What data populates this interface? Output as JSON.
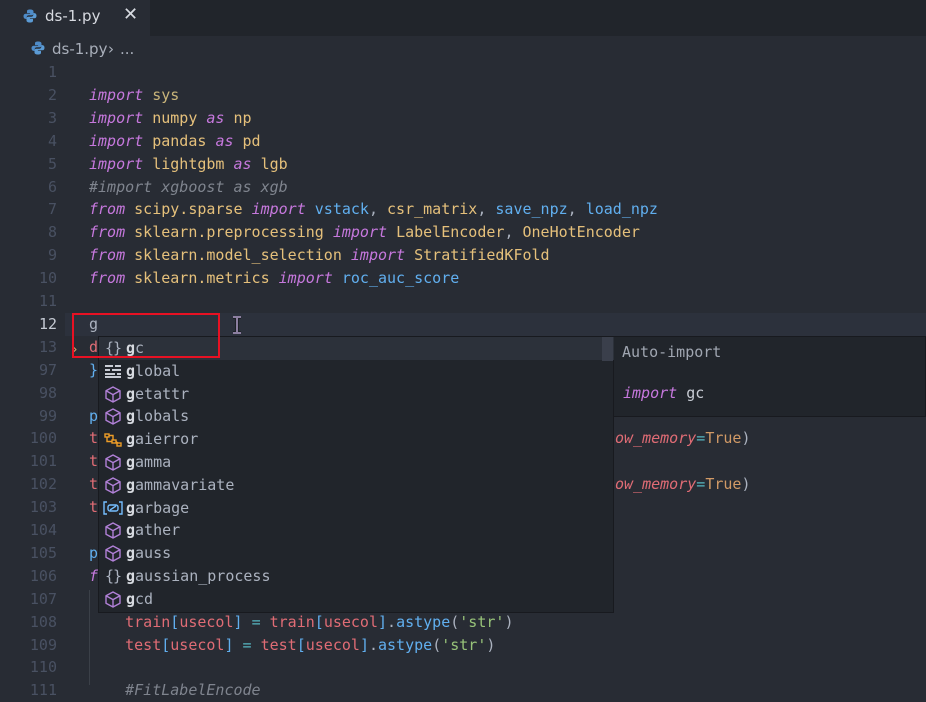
{
  "tab": {
    "filename": "ds-1.py",
    "close_glyph": "✕"
  },
  "breadcrumb": {
    "file": "ds-1.py",
    "separator": "›",
    "more": "..."
  },
  "editor": {
    "current_line": 12,
    "lines": [
      {
        "n": "1",
        "tokens": []
      },
      {
        "n": "2",
        "tokens": [
          [
            "kw",
            "import"
          ],
          [
            "pl",
            " "
          ],
          [
            "modd",
            "sys"
          ]
        ]
      },
      {
        "n": "3",
        "tokens": [
          [
            "kw",
            "import"
          ],
          [
            "pl",
            " "
          ],
          [
            "mod",
            "numpy"
          ],
          [
            "pl",
            " "
          ],
          [
            "kw",
            "as"
          ],
          [
            "pl",
            " "
          ],
          [
            "mod",
            "np"
          ]
        ]
      },
      {
        "n": "4",
        "tokens": [
          [
            "kw",
            "import"
          ],
          [
            "pl",
            " "
          ],
          [
            "mod",
            "pandas"
          ],
          [
            "pl",
            " "
          ],
          [
            "kw",
            "as"
          ],
          [
            "pl",
            " "
          ],
          [
            "mod",
            "pd"
          ]
        ]
      },
      {
        "n": "5",
        "tokens": [
          [
            "kw",
            "import"
          ],
          [
            "pl",
            " "
          ],
          [
            "mod",
            "lightgbm"
          ],
          [
            "pl",
            " "
          ],
          [
            "kw",
            "as"
          ],
          [
            "pl",
            " "
          ],
          [
            "mod",
            "lgb"
          ]
        ]
      },
      {
        "n": "6",
        "tokens": [
          [
            "cm",
            "#import xgboost as xgb"
          ]
        ]
      },
      {
        "n": "7",
        "tokens": [
          [
            "kw",
            "from"
          ],
          [
            "pl",
            " "
          ],
          [
            "mod",
            "scipy.sparse"
          ],
          [
            "pl",
            " "
          ],
          [
            "kw",
            "import"
          ],
          [
            "pl",
            " "
          ],
          [
            "fn",
            "vstack"
          ],
          [
            "pl",
            ", "
          ],
          [
            "mod",
            "csr_matrix"
          ],
          [
            "pl",
            ", "
          ],
          [
            "fn",
            "save_npz"
          ],
          [
            "pl",
            ", "
          ],
          [
            "fn",
            "load_npz"
          ]
        ]
      },
      {
        "n": "8",
        "tokens": [
          [
            "kw",
            "from"
          ],
          [
            "pl",
            " "
          ],
          [
            "mod",
            "sklearn.preprocessing"
          ],
          [
            "pl",
            " "
          ],
          [
            "kw",
            "import"
          ],
          [
            "pl",
            " "
          ],
          [
            "mod",
            "LabelEncoder"
          ],
          [
            "pl",
            ", "
          ],
          [
            "mod",
            "OneHotEncoder"
          ]
        ]
      },
      {
        "n": "9",
        "tokens": [
          [
            "kw",
            "from"
          ],
          [
            "pl",
            " "
          ],
          [
            "mod",
            "sklearn.model_selection"
          ],
          [
            "pl",
            " "
          ],
          [
            "kw",
            "import"
          ],
          [
            "pl",
            " "
          ],
          [
            "mod",
            "StratifiedKFold"
          ]
        ]
      },
      {
        "n": "10",
        "tokens": [
          [
            "kw",
            "from"
          ],
          [
            "pl",
            " "
          ],
          [
            "mod",
            "sklearn.metrics"
          ],
          [
            "pl",
            " "
          ],
          [
            "kw",
            "import"
          ],
          [
            "pl",
            " "
          ],
          [
            "fn",
            "roc_auc_score"
          ]
        ]
      },
      {
        "n": "11",
        "tokens": []
      },
      {
        "n": "12",
        "tokens": [
          [
            "pl",
            "g"
          ]
        ]
      },
      {
        "n": "13",
        "tokens": [
          [
            "var",
            "d"
          ]
        ]
      },
      {
        "n": "97",
        "tokens": [
          [
            "fn",
            "}"
          ]
        ]
      },
      {
        "n": "98",
        "tokens": []
      },
      {
        "n": "99",
        "tokens": [
          [
            "fn",
            "p"
          ]
        ]
      },
      {
        "n": "100",
        "tokens": [
          [
            "var",
            "t"
          ]
        ]
      },
      {
        "n": "101",
        "tokens": [
          [
            "var",
            "t"
          ]
        ]
      },
      {
        "n": "102",
        "tokens": [
          [
            "var",
            "t"
          ]
        ]
      },
      {
        "n": "103",
        "tokens": [
          [
            "var",
            "t"
          ]
        ]
      },
      {
        "n": "104",
        "tokens": []
      },
      {
        "n": "105",
        "tokens": [
          [
            "fn",
            "p"
          ]
        ]
      },
      {
        "n": "106",
        "tokens": [
          [
            "kw",
            "f"
          ]
        ]
      },
      {
        "n": "107",
        "tokens": []
      },
      {
        "n": "108",
        "tokens": [
          [
            "pl",
            "    "
          ],
          [
            "var",
            "train"
          ],
          [
            "fn",
            "["
          ],
          [
            "var",
            "usecol"
          ],
          [
            "fn",
            "]"
          ],
          [
            "pl",
            " "
          ],
          [
            "op",
            "="
          ],
          [
            "pl",
            " "
          ],
          [
            "var",
            "train"
          ],
          [
            "fn",
            "["
          ],
          [
            "var",
            "usecol"
          ],
          [
            "fn",
            "]"
          ],
          [
            "pl",
            "."
          ],
          [
            "fn",
            "astype"
          ],
          [
            "pl",
            "("
          ],
          [
            "str",
            "'str'"
          ],
          [
            "pl",
            ")"
          ]
        ]
      },
      {
        "n": "109",
        "tokens": [
          [
            "pl",
            "    "
          ],
          [
            "var",
            "test"
          ],
          [
            "fn",
            "["
          ],
          [
            "var",
            "usecol"
          ],
          [
            "fn",
            "]"
          ],
          [
            "pl",
            " "
          ],
          [
            "op",
            "="
          ],
          [
            "pl",
            " "
          ],
          [
            "var",
            "test"
          ],
          [
            "fn",
            "["
          ],
          [
            "var",
            "usecol"
          ],
          [
            "fn",
            "]"
          ],
          [
            "pl",
            "."
          ],
          [
            "fn",
            "astype"
          ],
          [
            "pl",
            "("
          ],
          [
            "str",
            "'str'"
          ],
          [
            "pl",
            ")"
          ]
        ]
      },
      {
        "n": "110",
        "tokens": []
      },
      {
        "n": "111",
        "tokens": [
          [
            "pl",
            "    "
          ],
          [
            "cm",
            "#FitLabelEncode"
          ]
        ]
      }
    ],
    "right_fragments": [
      {
        "line": "100",
        "tokens": [
          [
            "par",
            "ow_memory"
          ],
          [
            "op",
            "="
          ],
          [
            "num",
            "True"
          ],
          [
            "pl",
            ")"
          ]
        ]
      },
      {
        "line": "102",
        "tokens": [
          [
            "par",
            "ow_memory"
          ],
          [
            "op",
            "="
          ],
          [
            "num",
            "True"
          ],
          [
            "pl",
            ")"
          ]
        ]
      }
    ]
  },
  "suggestions": {
    "typed": "g",
    "items": [
      {
        "label": "gc",
        "kind": "module-icon",
        "selected": true
      },
      {
        "label": "global",
        "kind": "keyword-icon"
      },
      {
        "label": "getattr",
        "kind": "function-icon"
      },
      {
        "label": "globals",
        "kind": "function-icon"
      },
      {
        "label": "gaierror",
        "kind": "class-icon"
      },
      {
        "label": "gamma",
        "kind": "function-icon"
      },
      {
        "label": "gammavariate",
        "kind": "function-icon"
      },
      {
        "label": "garbage",
        "kind": "variable-icon"
      },
      {
        "label": "gather",
        "kind": "function-icon"
      },
      {
        "label": "gauss",
        "kind": "function-icon"
      },
      {
        "label": "gaussian_process",
        "kind": "module-icon"
      },
      {
        "label": "gcd",
        "kind": "function-icon"
      }
    ]
  },
  "details": {
    "title": "Auto-import",
    "keyword": "import",
    "module": "gc"
  },
  "colors": {
    "highlight_box": "#e81123",
    "background": "#282c34",
    "widget_bg": "#21252b"
  }
}
